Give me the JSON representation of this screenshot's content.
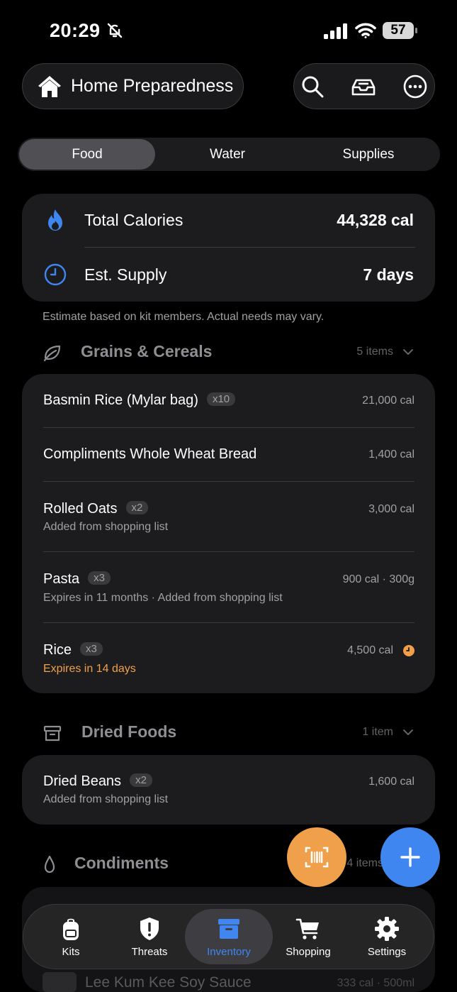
{
  "status_bar": {
    "time": "20:29",
    "battery": "57"
  },
  "header": {
    "kit_name": "Home Preparedness"
  },
  "segments": [
    "Food",
    "Water",
    "Supplies"
  ],
  "summary": {
    "calories_label": "Total Calories",
    "calories_value": "44,328 cal",
    "supply_label": "Est. Supply",
    "supply_value": "7 days",
    "note": "Estimate based on kit members. Actual needs may vary."
  },
  "sections": [
    {
      "title": "Grains & Cereals",
      "count": "5 items",
      "items": [
        {
          "name": "Basmin Rice (Mylar bag)",
          "qty": "x10",
          "value": "21,000 cal",
          "sub": ""
        },
        {
          "name": "Compliments Whole Wheat Bread",
          "qty": "",
          "value": "1,400 cal",
          "sub": ""
        },
        {
          "name": "Rolled Oats",
          "qty": "x2",
          "value": "3,000 cal",
          "sub": "Added from shopping list"
        },
        {
          "name": "Pasta",
          "qty": "x3",
          "value": "900 cal · 300g",
          "sub": "Expires in 11 months  ·  Added from shopping list"
        },
        {
          "name": "Rice",
          "qty": "x3",
          "value": "4,500 cal",
          "sub": "Expires in 14 days"
        }
      ]
    },
    {
      "title": "Dried Foods",
      "count": "1 item",
      "items": [
        {
          "name": "Dried Beans",
          "qty": "x2",
          "value": "1,600 cal",
          "sub": "Added from shopping list"
        }
      ]
    },
    {
      "title": "Condiments",
      "count": "4 items",
      "items": [
        {
          "name": "Lee Kum Kee Soy Sauce",
          "qty": "",
          "value": "333 cal · 500ml",
          "sub": ""
        }
      ]
    }
  ],
  "tabbar": [
    "Kits",
    "Threats",
    "Inventory",
    "Shopping",
    "Settings"
  ],
  "colors": {
    "accent": "#3f86f0",
    "warning": "#f0a04b",
    "card": "#1c1c1e",
    "background": "#000000"
  },
  "icons": {
    "status": [
      "bell-slash-icon",
      "signal-icon",
      "wifi-icon",
      "battery-icon"
    ],
    "header": [
      "house-icon",
      "search-icon",
      "tray-icon",
      "more-icon"
    ],
    "summary": [
      "flame-icon",
      "clock-icon"
    ],
    "sections": [
      "leaf-icon",
      "archive-box-icon",
      "drop-icon"
    ],
    "fabs": [
      "barcode-scan-icon",
      "plus-icon"
    ],
    "tabbar": [
      "backpack-icon",
      "shield-alert-icon",
      "inventory-box-icon",
      "cart-icon",
      "gear-icon"
    ]
  }
}
